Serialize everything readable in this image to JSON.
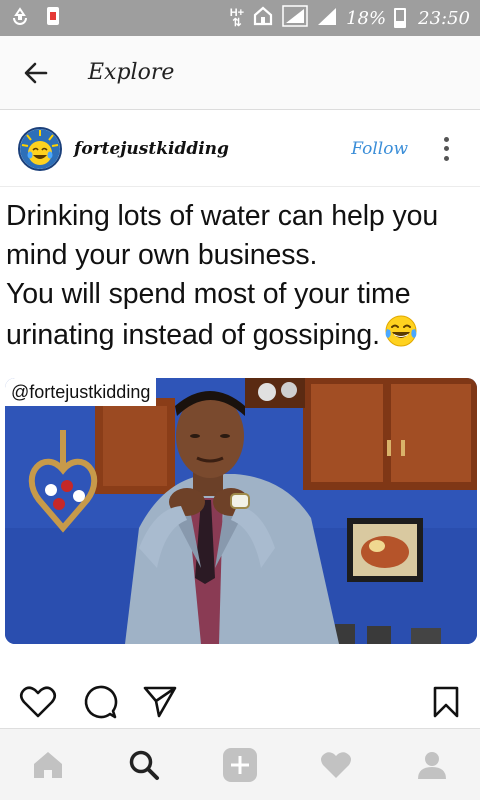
{
  "status_bar": {
    "network": "H+",
    "battery": "18%",
    "time": "23:50",
    "icons": [
      "recycle-icon",
      "notification-alert-icon",
      "data-arrows-icon",
      "home-icon",
      "signal-icon",
      "signal-icon",
      "battery-icon"
    ]
  },
  "app_bar": {
    "title": "Explore",
    "back_icon": "arrow-left-icon"
  },
  "post": {
    "username": "fortejustkidding",
    "follow_label": "Follow",
    "more_icon": "vertical-dots-icon",
    "caption_lines": [
      "Drinking lots of water can help you",
      "mind your own business.",
      "You will spend most of your time",
      "urinating instead of gossiping."
    ],
    "caption_emoji": "tears-of-joy-emoji",
    "image_watermark": "@fortejustkidding",
    "actions": [
      "heart-icon",
      "comment-icon",
      "share-icon",
      "bookmark-icon"
    ]
  },
  "bottom_nav": [
    "home-icon",
    "search-icon",
    "add-icon",
    "heart-icon",
    "profile-icon"
  ],
  "colors": {
    "status_bar": "#9e9e9e",
    "follow": "#3b8ed8",
    "nav_inactive": "#c2c2c2",
    "nav_active": "#222222"
  }
}
